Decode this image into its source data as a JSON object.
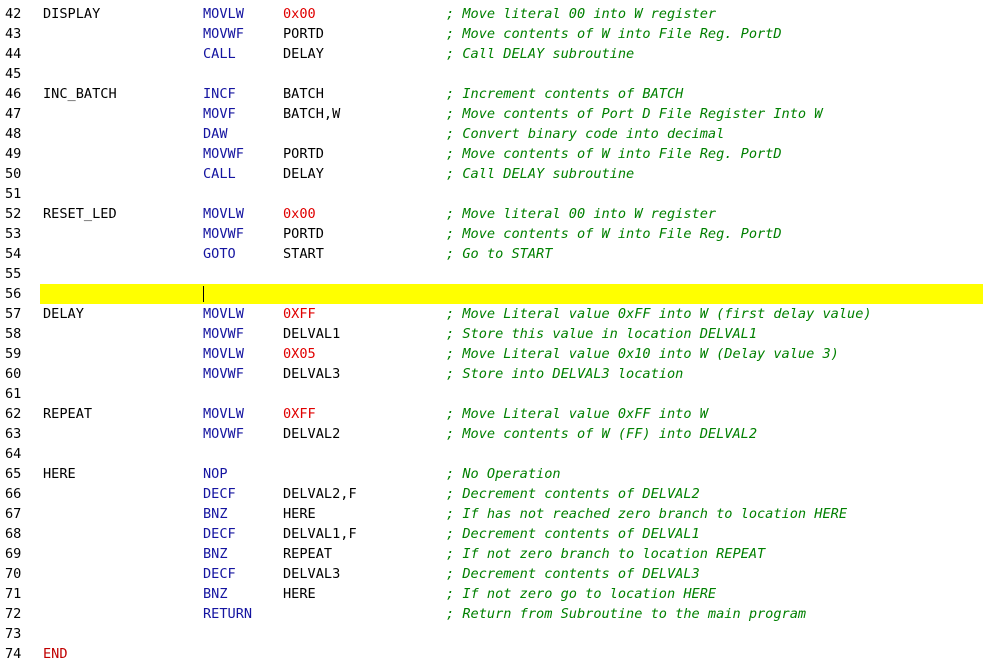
{
  "editor": {
    "highlight_line": "56",
    "colors": {
      "line_numbers": "#000000",
      "labels": "#000000",
      "end_directive": "#c00000",
      "mnemonics": "#1414a0",
      "operands": "#000000",
      "numeric_literals": "#e00000",
      "comments": "#008000",
      "current_line_highlight": "#ffff00",
      "background": "#ffffff"
    },
    "lines": [
      {
        "num": "42",
        "label": "DISPLAY",
        "mnemonic": "MOVLW",
        "operand": "0x00",
        "operand_is_literal": true,
        "comment": "; Move literal 00 into W register"
      },
      {
        "num": "43",
        "label": "",
        "mnemonic": "MOVWF",
        "operand": "PORTD",
        "operand_is_literal": false,
        "comment": "; Move contents of W into File Reg. PortD"
      },
      {
        "num": "44",
        "label": "",
        "mnemonic": "CALL",
        "operand": "DELAY",
        "operand_is_literal": false,
        "comment": "; Call DELAY subroutine"
      },
      {
        "num": "45",
        "label": "",
        "mnemonic": "",
        "operand": "",
        "operand_is_literal": false,
        "comment": ""
      },
      {
        "num": "46",
        "label": "INC_BATCH",
        "mnemonic": "INCF",
        "operand": "BATCH",
        "operand_is_literal": false,
        "comment": "; Increment contents of BATCH"
      },
      {
        "num": "47",
        "label": "",
        "mnemonic": "MOVF",
        "operand": "BATCH,W",
        "operand_is_literal": false,
        "comment": "; Move contents of Port D File Register Into W"
      },
      {
        "num": "48",
        "label": "",
        "mnemonic": "DAW",
        "operand": "",
        "operand_is_literal": false,
        "comment": "; Convert binary code into decimal"
      },
      {
        "num": "49",
        "label": "",
        "mnemonic": "MOVWF",
        "operand": "PORTD",
        "operand_is_literal": false,
        "comment": "; Move contents of W into File Reg. PortD"
      },
      {
        "num": "50",
        "label": "",
        "mnemonic": "CALL",
        "operand": "DELAY",
        "operand_is_literal": false,
        "comment": "; Call DELAY subroutine"
      },
      {
        "num": "51",
        "label": "",
        "mnemonic": "",
        "operand": "",
        "operand_is_literal": false,
        "comment": ""
      },
      {
        "num": "52",
        "label": "RESET_LED",
        "mnemonic": "MOVLW",
        "operand": "0x00",
        "operand_is_literal": true,
        "comment": "; Move literal 00 into W register"
      },
      {
        "num": "53",
        "label": "",
        "mnemonic": "MOVWF",
        "operand": "PORTD",
        "operand_is_literal": false,
        "comment": "; Move contents of W into File Reg. PortD"
      },
      {
        "num": "54",
        "label": "",
        "mnemonic": "GOTO",
        "operand": "START",
        "operand_is_literal": false,
        "comment": "; Go to START"
      },
      {
        "num": "55",
        "label": "",
        "mnemonic": "",
        "operand": "",
        "operand_is_literal": false,
        "comment": ""
      },
      {
        "num": "56",
        "label": "",
        "mnemonic": "",
        "operand": "",
        "operand_is_literal": false,
        "comment": ""
      },
      {
        "num": "57",
        "label": "DELAY",
        "mnemonic": "MOVLW",
        "operand": "0XFF",
        "operand_is_literal": true,
        "comment": "; Move Literal value 0xFF into W (first delay value)"
      },
      {
        "num": "58",
        "label": "",
        "mnemonic": "MOVWF",
        "operand": "DELVAL1",
        "operand_is_literal": false,
        "comment": "; Store this value in location DELVAL1"
      },
      {
        "num": "59",
        "label": "",
        "mnemonic": "MOVLW",
        "operand": "0X05",
        "operand_is_literal": true,
        "comment": "; Move Literal value 0x10 into W (Delay value 3)"
      },
      {
        "num": "60",
        "label": "",
        "mnemonic": "MOVWF",
        "operand": "DELVAL3",
        "operand_is_literal": false,
        "comment": "; Store into DELVAL3 location"
      },
      {
        "num": "61",
        "label": "",
        "mnemonic": "",
        "operand": "",
        "operand_is_literal": false,
        "comment": ""
      },
      {
        "num": "62",
        "label": "REPEAT",
        "mnemonic": "MOVLW",
        "operand": "0XFF",
        "operand_is_literal": true,
        "comment": "; Move Literal value 0xFF into W"
      },
      {
        "num": "63",
        "label": "",
        "mnemonic": "MOVWF",
        "operand": "DELVAL2",
        "operand_is_literal": false,
        "comment": "; Move contents of W (FF) into DELVAL2"
      },
      {
        "num": "64",
        "label": "",
        "mnemonic": "",
        "operand": "",
        "operand_is_literal": false,
        "comment": ""
      },
      {
        "num": "65",
        "label": "HERE",
        "mnemonic": "NOP",
        "operand": "",
        "operand_is_literal": false,
        "comment": "; No Operation"
      },
      {
        "num": "66",
        "label": "",
        "mnemonic": "DECF",
        "operand": "DELVAL2,F",
        "operand_is_literal": false,
        "comment": "; Decrement contents of DELVAL2"
      },
      {
        "num": "67",
        "label": "",
        "mnemonic": "BNZ",
        "operand": "HERE",
        "operand_is_literal": false,
        "comment": "; If has not reached zero branch to location HERE"
      },
      {
        "num": "68",
        "label": "",
        "mnemonic": "DECF",
        "operand": "DELVAL1,F",
        "operand_is_literal": false,
        "comment": "; Decrement contents of DELVAL1"
      },
      {
        "num": "69",
        "label": "",
        "mnemonic": "BNZ",
        "operand": "REPEAT",
        "operand_is_literal": false,
        "comment": "; If not zero branch to location REPEAT"
      },
      {
        "num": "70",
        "label": "",
        "mnemonic": "DECF",
        "operand": "DELVAL3",
        "operand_is_literal": false,
        "comment": "; Decrement contents of DELVAL3"
      },
      {
        "num": "71",
        "label": "",
        "mnemonic": "BNZ",
        "operand": "HERE",
        "operand_is_literal": false,
        "comment": "; If not zero go to location HERE"
      },
      {
        "num": "72",
        "label": "",
        "mnemonic": "RETURN",
        "operand": "",
        "operand_is_literal": false,
        "comment": "; Return from Subroutine to the main program"
      },
      {
        "num": "73",
        "label": "",
        "mnemonic": "",
        "operand": "",
        "operand_is_literal": false,
        "comment": ""
      },
      {
        "num": "74",
        "label": "END",
        "mnemonic": "",
        "operand": "",
        "operand_is_literal": false,
        "comment": ""
      }
    ]
  }
}
